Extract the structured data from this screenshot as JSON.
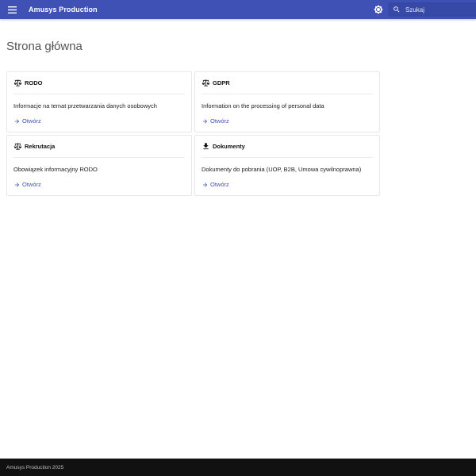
{
  "header": {
    "title": "Amusys Production",
    "menu_icon": "menu-icon",
    "theme_icon": "brightness-icon",
    "search": {
      "placeholder": "Szukaj",
      "value": "",
      "icon": "search-icon"
    },
    "color": "#3f51b5"
  },
  "page": {
    "title": "Strona główna"
  },
  "cards": [
    {
      "icon": "scale-icon",
      "title": "RODO",
      "description": "Informacje na temat przetwarzania danych osobowych",
      "link": "Otwórz"
    },
    {
      "icon": "scale-icon",
      "title": "GDPR",
      "description": "Information on the processing of personal data",
      "link": "Otwórz"
    },
    {
      "icon": "scale-icon",
      "title": "Rekrutacja",
      "description": "Obowiązek informacyjny RODO",
      "link": "Otwórz"
    },
    {
      "icon": "download-icon",
      "title": "Dokumenty",
      "description": "Dokumenty do pobrania (UOP, B2B, Umowa cywilnoprawna)",
      "link": "Otwórz"
    }
  ],
  "footer": {
    "text": "Amusys Production 2025"
  }
}
